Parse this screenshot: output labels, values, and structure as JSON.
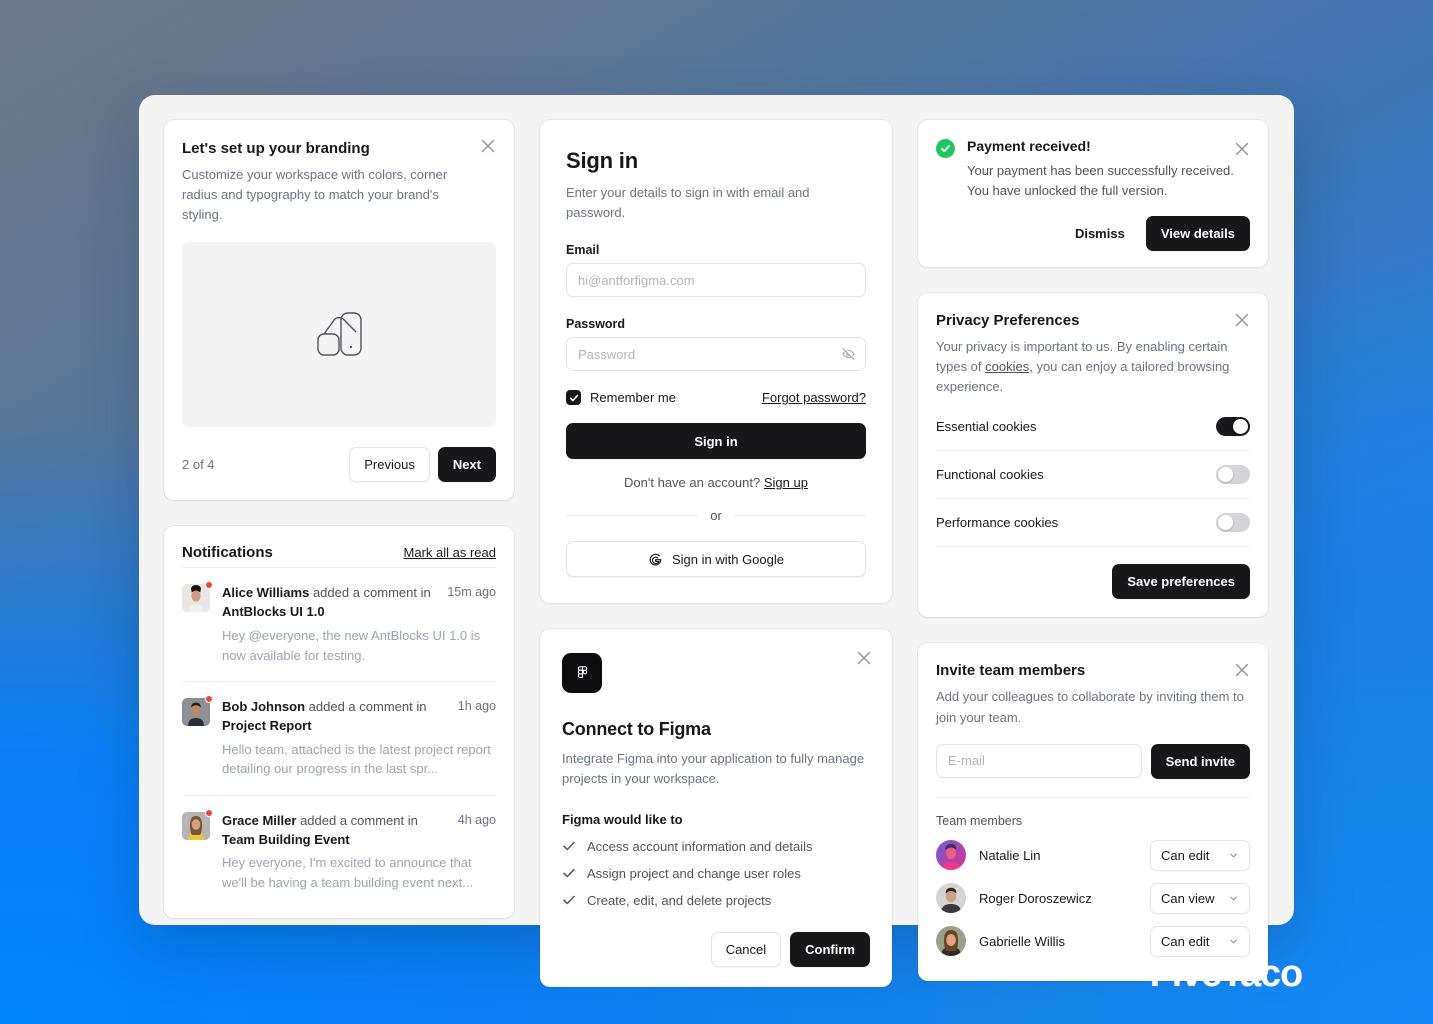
{
  "branding": {
    "title": "Let's set up your branding",
    "description": "Customize your workspace with colors, corner radius and typography to match your brand's styling.",
    "step": "2 of 4",
    "previous_label": "Previous",
    "next_label": "Next"
  },
  "notifications": {
    "title": "Notifications",
    "mark_all_label": "Mark all as read",
    "items": [
      {
        "user": "Alice Williams",
        "action": "added a comment in",
        "target": "AntBlocks UI 1.0",
        "time": "15m ago",
        "message": "Hey @everyone, the new AntBlocks UI 1.0 is now available for testing."
      },
      {
        "user": "Bob Johnson",
        "action": "added a comment in",
        "target": "Project Report",
        "time": "1h ago",
        "message": "Hello team, attached is the latest project report detailing our progress in the last spr..."
      },
      {
        "user": "Grace Miller",
        "action": "added a comment in",
        "target": "Team Building Event",
        "time": "4h ago",
        "message": "Hey everyone, I'm excited to announce that we'll be having a team building event next..."
      }
    ]
  },
  "signin": {
    "title": "Sign in",
    "subtitle": "Enter your details to sign in with email and password.",
    "email_label": "Email",
    "email_placeholder": "hi@antforfigma.com",
    "email_value": "",
    "password_label": "Password",
    "password_placeholder": "Password",
    "password_value": "",
    "remember_label": "Remember me",
    "remember_checked": true,
    "forgot_label": "Forgot password?",
    "submit_label": "Sign in",
    "signup_prompt": "Don't have an account?",
    "signup_label": "Sign up",
    "or_label": "or",
    "google_label": "Sign in with Google"
  },
  "figma": {
    "title": "Connect to Figma",
    "description": "Integrate Figma into your application to fully manage projects in your workspace.",
    "permissions_heading": "Figma would like to",
    "permissions": [
      "Access account information and details",
      "Assign project and change user roles",
      "Create, edit, and delete projects"
    ],
    "cancel_label": "Cancel",
    "confirm_label": "Confirm"
  },
  "toast": {
    "title": "Payment received!",
    "message": "Your payment has been successfully received. You have unlocked the full version.",
    "dismiss_label": "Dismiss",
    "view_label": "View details",
    "accent_color": "#22c55e"
  },
  "privacy": {
    "title": "Privacy Preferences",
    "description_part1": "Your privacy is important to us. By enabling certain types of ",
    "description_link": "cookies,",
    "description_part2": " you can enjoy a tailored browsing experience.",
    "preferences": [
      {
        "label": "Essential cookies",
        "enabled": true
      },
      {
        "label": "Functional cookies",
        "enabled": false
      },
      {
        "label": "Performance cookies",
        "enabled": false
      }
    ],
    "save_label": "Save preferences"
  },
  "invite": {
    "title": "Invite team members",
    "description": "Add your colleagues to collaborate by inviting them to join your team.",
    "email_placeholder": "E-mail",
    "email_value": "",
    "send_label": "Send invite",
    "team_members_label": "Team members",
    "members": [
      {
        "name": "Natalie Lin",
        "role": "Can edit"
      },
      {
        "name": "Roger Doroszewicz",
        "role": "Can view"
      },
      {
        "name": "Gabrielle Willis",
        "role": "Can edit"
      }
    ]
  },
  "watermark": {
    "text": "FiveTaco"
  }
}
